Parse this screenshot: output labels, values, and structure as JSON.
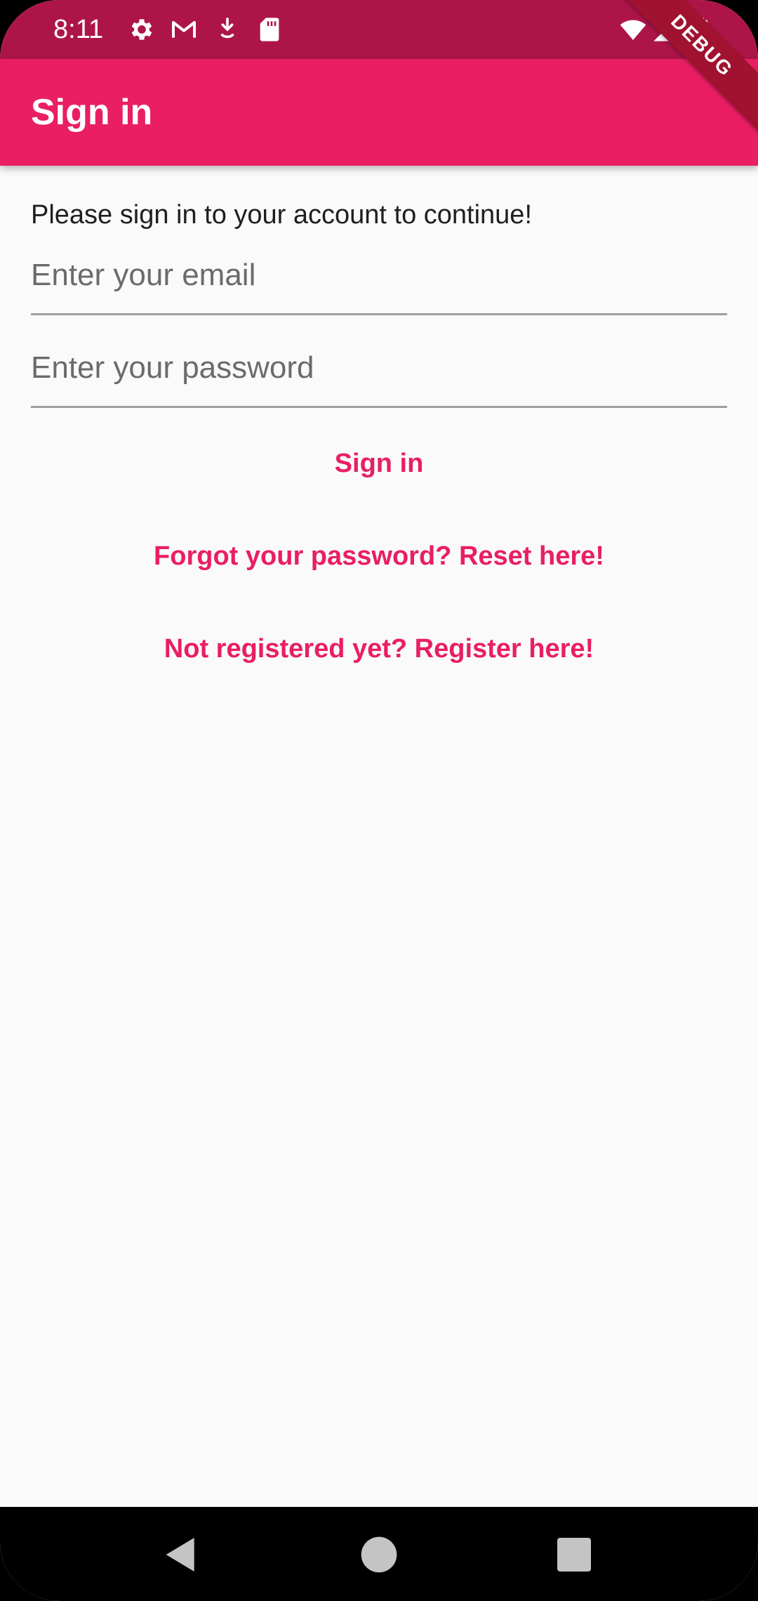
{
  "status_bar": {
    "time": "8:11",
    "left_icons": [
      "gear-icon",
      "gmail-icon",
      "download-icon",
      "sd-card-icon"
    ],
    "right_icons": [
      "wifi-icon",
      "cellular-signal-icon",
      "battery-icon"
    ]
  },
  "debug_banner": {
    "label": "DEBUG"
  },
  "app_bar": {
    "title": "Sign in",
    "color": "#e91e63"
  },
  "main": {
    "intro": "Please sign in to your account to continue!",
    "email_placeholder": "Enter your email",
    "email_value": "",
    "password_placeholder": "Enter your password",
    "password_value": "",
    "sign_in_label": "Sign in",
    "forgot_label": "Forgot your password? Reset here!",
    "register_label": "Not registered yet? Register here!"
  },
  "nav_bar": {
    "buttons": [
      "back-icon",
      "home-icon",
      "recents-icon"
    ]
  },
  "colors": {
    "accent": "#e91e63",
    "status_bar": "#ad1548",
    "background": "#fafafa"
  }
}
